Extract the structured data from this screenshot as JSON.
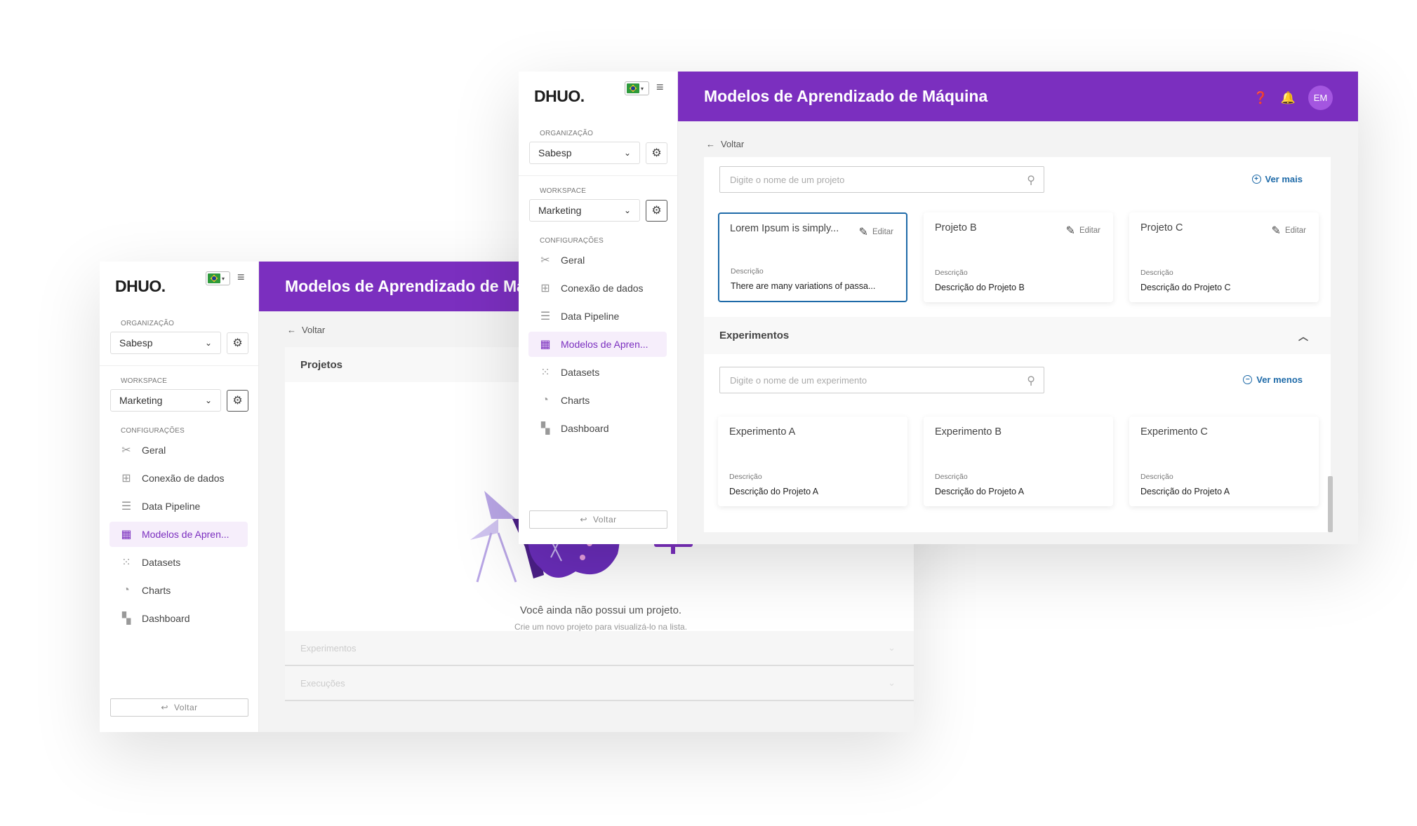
{
  "logo": "DHUO.",
  "sidebar": {
    "org_label": "ORGANIZAÇÃO",
    "org_value": "Sabesp",
    "workspace_label": "WORKSPACE",
    "workspace_value": "Marketing",
    "config_label": "CONFIGURAÇÕES",
    "items": [
      {
        "label": "Geral",
        "icon": "tools-icon"
      },
      {
        "label": "Conexão de dados",
        "icon": "data-connection-icon"
      },
      {
        "label": "Data Pipeline",
        "icon": "pipeline-icon"
      },
      {
        "label": "Modelos de Apren...",
        "icon": "ml-models-icon",
        "active": true
      },
      {
        "label": "Datasets",
        "icon": "datasets-icon"
      },
      {
        "label": "Charts",
        "icon": "chart-pie-icon"
      },
      {
        "label": "Dashboard",
        "icon": "dashboard-icon"
      }
    ],
    "back_button": "Voltar"
  },
  "back_window": {
    "title": "Modelos de Aprendizado de Máquina",
    "voltar": "Voltar",
    "panel_title": "Projetos",
    "empty_title": "Você ainda não possui um projeto.",
    "empty_subtitle": "Crie um novo projeto para visualizá-lo na lista.",
    "faded_rows": [
      "Experimentos",
      "Execuções"
    ]
  },
  "front_window": {
    "title": "Modelos de Aprendizado de Máquina",
    "avatar_initials": "EM",
    "voltar": "Voltar",
    "projects": {
      "search_placeholder": "Digite o nome de um projeto",
      "more_link": "Ver mais",
      "edit_label": "Editar",
      "desc_label": "Descrição",
      "cards": [
        {
          "title": "Lorem Ipsum is simply...",
          "desc": "There are many variations of passa..."
        },
        {
          "title": "Projeto B",
          "desc": "Descrição do Projeto B"
        },
        {
          "title": "Projeto C",
          "desc": "Descrição do Projeto C"
        }
      ]
    },
    "experiments": {
      "title": "Experimentos",
      "search_placeholder": "Digite o nome de um experimento",
      "less_link": "Ver menos",
      "desc_label": "Descrição",
      "cards": [
        {
          "title": "Experimento A",
          "desc": "Descrição do Projeto A"
        },
        {
          "title": "Experimento B",
          "desc": "Descrição do Projeto A"
        },
        {
          "title": "Experimento C",
          "desc": "Descrição do Projeto A"
        }
      ]
    }
  },
  "colors": {
    "brand_purple": "#7b2fbf",
    "link_blue": "#1e6aa8",
    "active_bg": "#f6eefb"
  }
}
